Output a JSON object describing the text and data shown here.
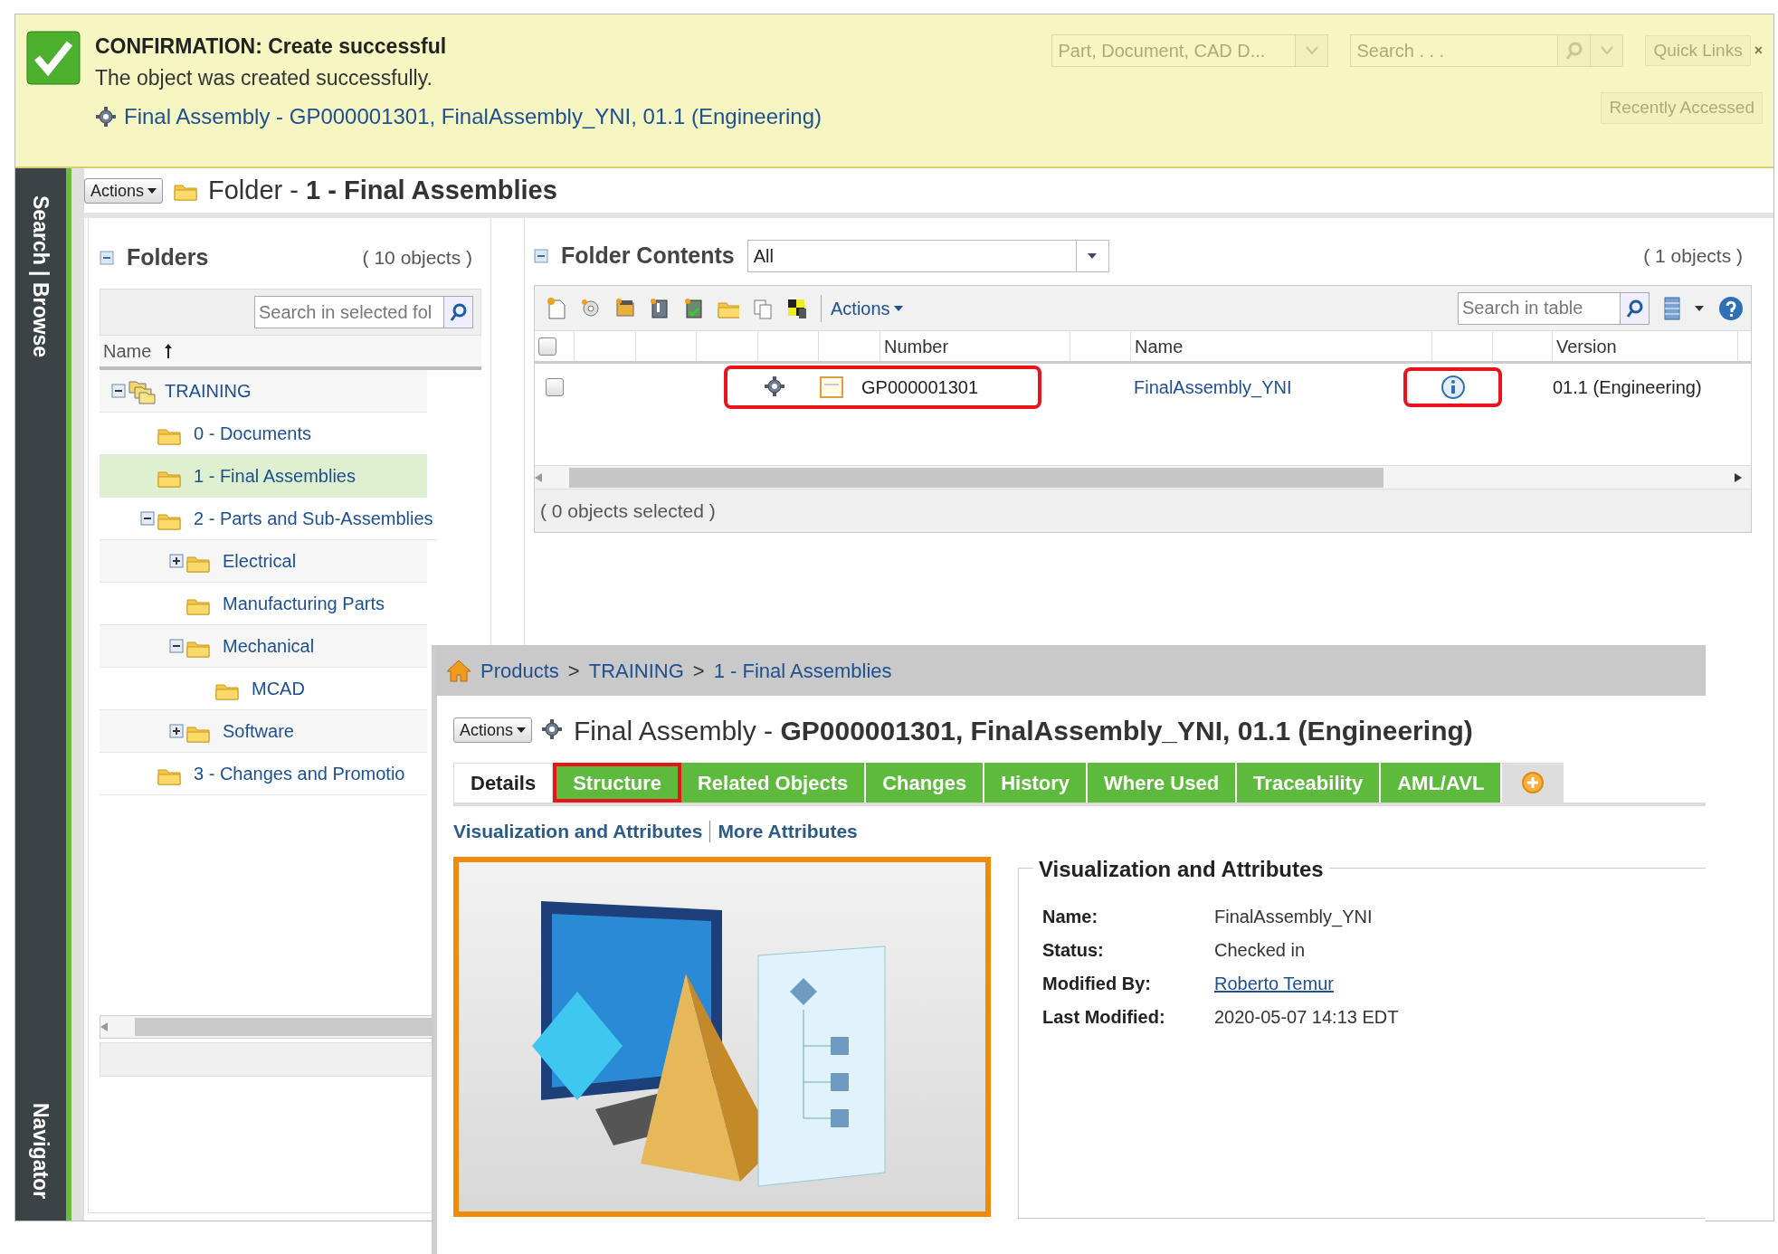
{
  "confirmation": {
    "title": "CONFIRMATION: Create successful",
    "message": "The object was created successfully.",
    "object_link": "Final Assembly - GP000001301, FinalAssembly_YNI, 01.1 (Engineering)"
  },
  "header": {
    "type_field": {
      "value": "Part, Document, CAD D..."
    },
    "search_field": {
      "placeholder": "Search . . ."
    },
    "quick_links": "Quick Links",
    "close": "×",
    "recently_accessed": "Recently Accessed"
  },
  "side_tabs": [
    "Search | Browse",
    "Navigator"
  ],
  "page": {
    "actions": "Actions",
    "title": "Folder - **1 - Final Assemblies**"
  },
  "folders": {
    "title": "Folders",
    "count": "( 10 objects )",
    "search": {
      "placeholder": "Search in selected fol"
    },
    "column": "Name",
    "tree": [
      {
        "label": "TRAINING",
        "kind": "library",
        "selected": false,
        "expanded": true,
        "children": [
          {
            "label": "0 - Documents",
            "kind": "folder",
            "selected": false
          },
          {
            "label": "1 - Final Assemblies",
            "kind": "folder",
            "selected": true
          },
          {
            "label": "2 - Parts and Sub-Assemblies",
            "kind": "folder",
            "selected": false,
            "expanded": true,
            "children": [
              {
                "label": "Electrical",
                "kind": "folder",
                "selected": false,
                "expanded": false
              },
              {
                "label": "Manufacturing Parts",
                "kind": "folder",
                "selected": false
              },
              {
                "label": "Mechanical",
                "kind": "folder",
                "selected": false,
                "expanded": true,
                "children": [
                  {
                    "label": "MCAD",
                    "kind": "folder",
                    "selected": false
                  }
                ]
              },
              {
                "label": "Software",
                "kind": "folder",
                "selected": false,
                "expanded": false
              }
            ]
          },
          {
            "label": "3 - Changes and Promotio",
            "kind": "folder",
            "selected": false
          }
        ]
      }
    ]
  },
  "contents": {
    "title": "Folder Contents",
    "view": "All",
    "count": "( 1 objects )",
    "actions": "Actions",
    "search": {
      "placeholder": "Search in table"
    },
    "columns": [
      "Number",
      "Name",
      "Version"
    ],
    "all_checked": false,
    "rows": [
      {
        "checked": false,
        "number": "GP000001301",
        "name": "FinalAssembly_YNI",
        "version": "01.1 (Engineering)",
        "number_highlighted": true,
        "info_highlighted": true
      }
    ],
    "selection_status": "( 0 objects selected )"
  },
  "detail": {
    "breadcrumb": [
      "Products",
      "TRAINING",
      "1 - Final Assemblies"
    ],
    "separator": ">",
    "actions": "Actions",
    "title": "Final Assembly - **GP000001301, FinalAssembly_YNI, 01.1 (Engineering)**",
    "tabs": [
      {
        "label": "Details",
        "selected": true,
        "highlighted": false
      },
      {
        "label": "Structure",
        "selected": false,
        "highlighted": true
      },
      {
        "label": "Related Objects",
        "selected": false,
        "highlighted": false
      },
      {
        "label": "Changes",
        "selected": false,
        "highlighted": false
      },
      {
        "label": "History",
        "selected": false,
        "highlighted": false
      },
      {
        "label": "Where Used",
        "selected": false,
        "highlighted": false
      },
      {
        "label": "Traceability",
        "selected": false,
        "highlighted": false
      },
      {
        "label": "AML/AVL",
        "selected": false,
        "highlighted": false
      }
    ],
    "subtabs": [
      "Visualization and Attributes",
      "More Attributes"
    ],
    "section_title": "Visualization and Attributes",
    "attributes": [
      {
        "label": "Name:",
        "value": "FinalAssembly_YNI",
        "kind": "text"
      },
      {
        "label": "Status:",
        "value": "Checked in",
        "kind": "text"
      },
      {
        "label": "Modified By:",
        "value": "Roberto Temur",
        "kind": "link"
      },
      {
        "label": "Last Modified:",
        "value": "2020-05-07 14:13 EDT",
        "kind": "text"
      }
    ]
  }
}
